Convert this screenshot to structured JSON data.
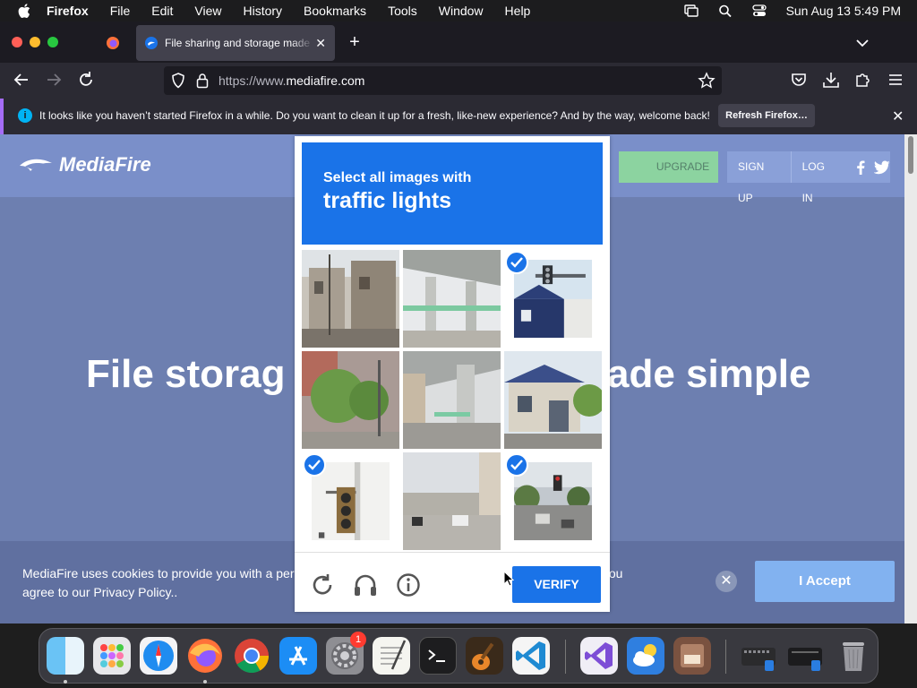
{
  "menubar": {
    "app": "Firefox",
    "items": [
      "File",
      "Edit",
      "View",
      "History",
      "Bookmarks",
      "Tools",
      "Window",
      "Help"
    ],
    "clock": "Sun Aug 13  5:49 PM"
  },
  "tab": {
    "title": "File sharing and storage made simple"
  },
  "urlbar": {
    "prefix": "https://www.",
    "domain": "mediafire.com"
  },
  "notification": {
    "message": "It looks like you haven’t started Firefox in a while. Do you want to clean it up for a fresh, like-new experience? And by the way, welcome back!",
    "button": "Refresh Firefox…"
  },
  "site": {
    "logo": "MediaFire",
    "upgrade": "UPGRADE",
    "signup": "SIGN UP",
    "login": "LOG IN",
    "hero_left": "File storag",
    "hero_right": "ade simple"
  },
  "captcha": {
    "prompt": "Select all images with",
    "target": "traffic lights",
    "verify": "VERIFY",
    "tiles_selected": [
      false,
      false,
      true,
      false,
      false,
      false,
      true,
      false,
      true
    ]
  },
  "cookie": {
    "text": "MediaFire uses cookies to provide you with a perso                                                                              e, you agree to our Privacy Policy..",
    "line1": "MediaFire uses cookies to provide you with a perso",
    "line1_end": "e, you",
    "line2": "agree to our Privacy Policy..",
    "accept": "I Accept"
  },
  "dock": {
    "badge": "1"
  },
  "colors": {
    "accent": "#1a73e8",
    "page_bg": "#6d7fb0"
  }
}
